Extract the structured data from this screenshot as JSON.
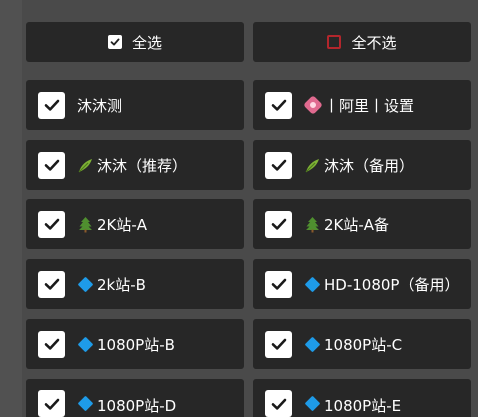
{
  "toolbar": {
    "select_all_label": "全选",
    "select_none_label": "全不选"
  },
  "sources": [
    {
      "label": "沐沐测",
      "icon": "",
      "checked": true
    },
    {
      "label": "丨阿里丨设置",
      "icon": "flower-icon",
      "checked": true
    },
    {
      "label": "沐沐（推荐）",
      "icon": "leaf-icon",
      "checked": true
    },
    {
      "label": "沐沐（备用）",
      "icon": "leaf-icon",
      "checked": true
    },
    {
      "label": "2K站-A",
      "icon": "tree-icon",
      "checked": true
    },
    {
      "label": "2K站-A备",
      "icon": "tree-icon",
      "checked": true
    },
    {
      "label": "2k站-B",
      "icon": "diamond-icon",
      "checked": true
    },
    {
      "label": "HD-1080P（备用）",
      "icon": "diamond-icon",
      "checked": true
    },
    {
      "label": "1080P站-B",
      "icon": "diamond-icon",
      "checked": true
    },
    {
      "label": "1080P站-C",
      "icon": "diamond-icon",
      "checked": true
    },
    {
      "label": "1080P站-D",
      "icon": "diamond-icon",
      "checked": true
    },
    {
      "label": "1080P站-E",
      "icon": "diamond-icon",
      "checked": true
    }
  ],
  "colors": {
    "button_bg": "#272727",
    "checkbox_fill": "#ffffff",
    "unchecked_border": "#b3262c",
    "diamond_blue": "#1e9be8"
  }
}
